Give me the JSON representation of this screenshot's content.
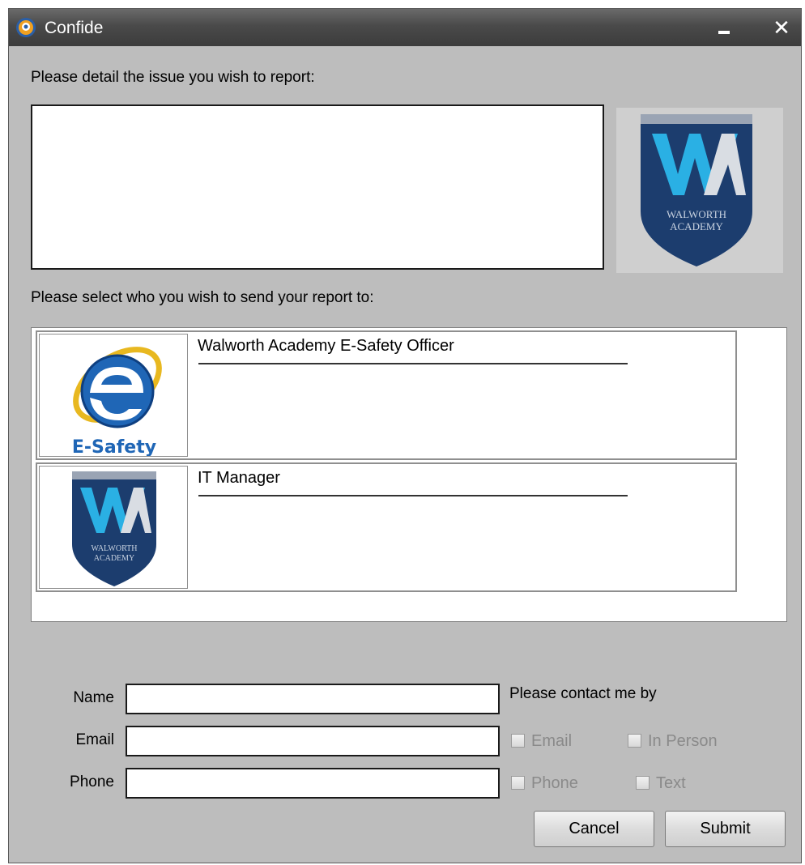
{
  "window": {
    "title": "Confide",
    "app_icon": "confide-app-icon",
    "minimize_icon": "minimize-icon",
    "close_icon": "close-icon",
    "close_glyph": "✕"
  },
  "issue": {
    "prompt": "Please detail the issue you wish to report:",
    "value": "",
    "logo": {
      "name": "walworth-academy-logo",
      "text_line1": "WALWORTH",
      "text_line2": "ACADEMY"
    }
  },
  "recipients": {
    "prompt": "Please select who you wish to send your report to:",
    "items": [
      {
        "name": "Walworth Academy E-Safety Officer",
        "icon": "e-safety-icon",
        "icon_caption": "E-Safety"
      },
      {
        "name": "IT Manager",
        "icon": "walworth-academy-logo",
        "logo_text_line1": "WALWORTH",
        "logo_text_line2": "ACADEMY"
      }
    ]
  },
  "form": {
    "name_label": "Name",
    "email_label": "Email",
    "phone_label": "Phone",
    "name_value": "",
    "email_value": "",
    "phone_value": ""
  },
  "contact": {
    "heading": "Please contact me by",
    "options": [
      {
        "label": "Email",
        "checked": false,
        "enabled": false
      },
      {
        "label": "In Person",
        "checked": false,
        "enabled": false
      },
      {
        "label": "Phone",
        "checked": false,
        "enabled": false
      },
      {
        "label": "Text",
        "checked": false,
        "enabled": false
      }
    ]
  },
  "buttons": {
    "cancel": "Cancel",
    "submit": "Submit"
  },
  "colors": {
    "window_bg": "#bdbdbd",
    "titlebar": "#4a4a4a",
    "logo_navy": "#1c3d6e",
    "logo_cyan": "#2ab0e4",
    "e_safety_blue": "#1f66b6",
    "e_safety_ring": "#e8b820"
  }
}
